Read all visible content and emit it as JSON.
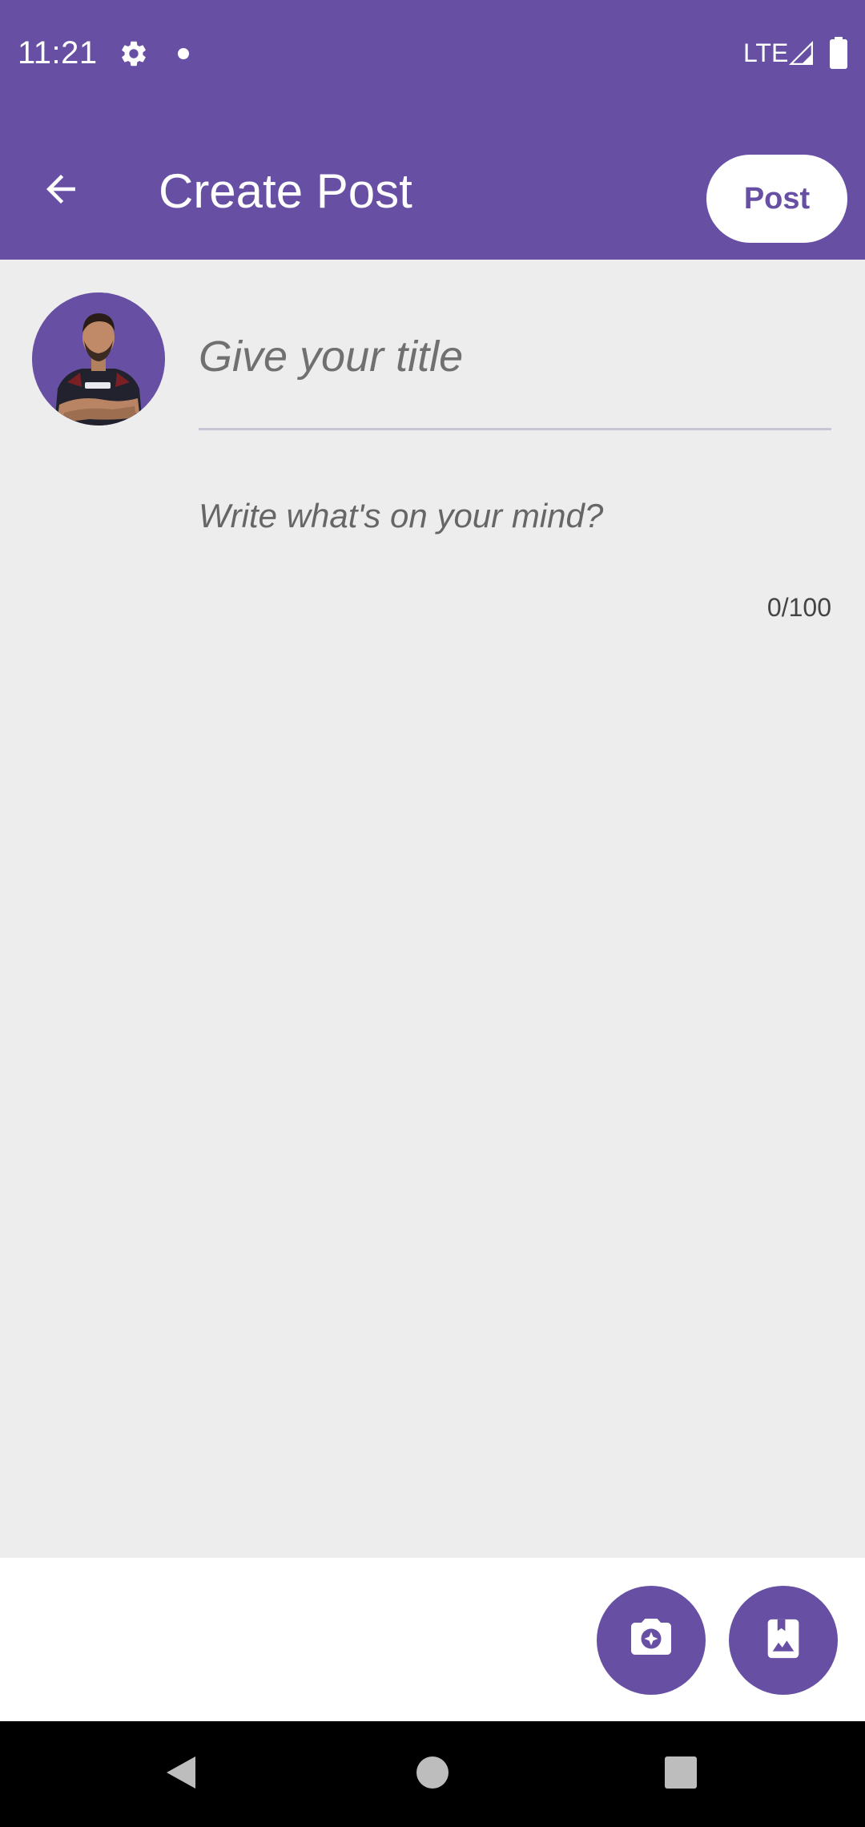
{
  "status_bar": {
    "time": "11:21",
    "network": "LTE",
    "icons": [
      "gear-icon",
      "notification-dot-icon",
      "signal-icon",
      "battery-icon"
    ]
  },
  "app_bar": {
    "title": "Create Post",
    "back_icon": "arrow-left-icon",
    "post_label": "Post"
  },
  "composer": {
    "avatar_icon": "user-avatar",
    "title_placeholder": "Give your title",
    "title_value": "",
    "body_placeholder": "Write what's on your mind?",
    "body_value": "",
    "char_count": "0/100"
  },
  "attach_bar": {
    "camera_icon": "camera-icon",
    "gallery_icon": "image-bookmark-icon"
  },
  "nav_bar": {
    "icons": [
      "nav-back-icon",
      "nav-home-icon",
      "nav-recents-icon"
    ]
  },
  "colors": {
    "primary": "#6750a4",
    "background": "#ededed",
    "surface": "#ffffff",
    "nav": "#000000"
  }
}
